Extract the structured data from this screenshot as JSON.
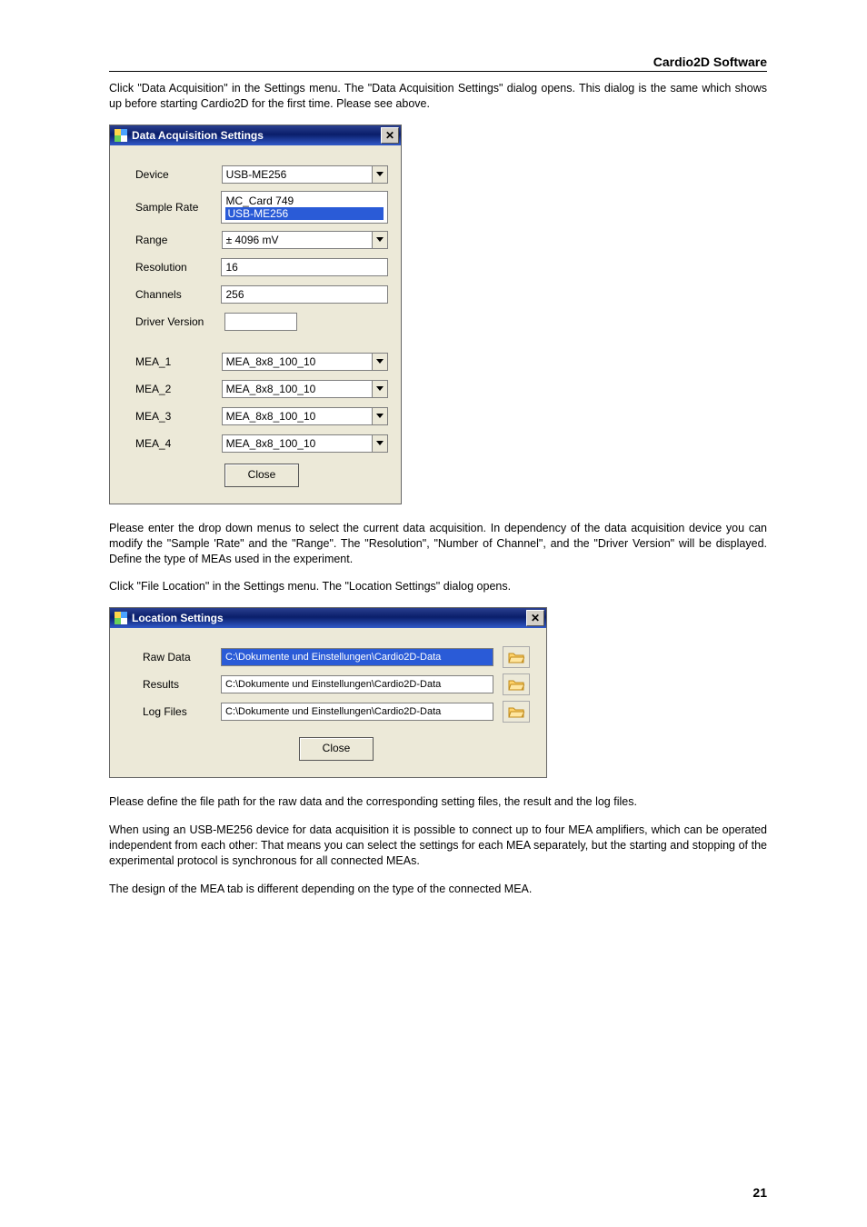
{
  "header": "Cardio2D Software",
  "para1": "Click \"Data Acquisition\" in the Settings menu. The \"Data Acquisition Settings\" dialog opens. This dialog is the same which shows up before starting Cardio2D for the first time. Please see above.",
  "dialog1": {
    "title": "Data Acquisition Settings",
    "labels": {
      "device": "Device",
      "sample_rate": "Sample Rate",
      "range": "Range",
      "resolution": "Resolution",
      "channels": "Channels",
      "driver_version": "Driver Version",
      "mea1": "MEA_1",
      "mea2": "MEA_2",
      "mea3": "MEA_3",
      "mea4": "MEA_4"
    },
    "values": {
      "device": "USB-ME256",
      "sample_rate_opt1": "MC_Card 749",
      "sample_rate_opt2": "USB-ME256",
      "range": "± 4096 mV",
      "resolution": "16",
      "channels": "256",
      "driver_version": "",
      "mea1": "MEA_8x8_100_10",
      "mea2": "MEA_8x8_100_10",
      "mea3": "MEA_8x8_100_10",
      "mea4": "MEA_8x8_100_10"
    },
    "close": "Close"
  },
  "para2": "Please enter the drop down menus to select the current data acquisition. In dependency of the data acquisition device you can modify the \"Sample 'Rate\" and the \"Range\". The \"Resolution\", \"Number of Channel\", and the \"Driver Version\" will be displayed. Define the type of MEAs used in the experiment.",
  "para3": "Click \"File Location\" in the Settings menu. The \"Location Settings\" dialog opens.",
  "dialog2": {
    "title": "Location Settings",
    "labels": {
      "raw": "Raw Data",
      "results": "Results",
      "logs": "Log Files"
    },
    "values": {
      "raw": "C:\\Dokumente und Einstellungen\\Cardio2D-Data",
      "results": "C:\\Dokumente und Einstellungen\\Cardio2D-Data",
      "logs": "C:\\Dokumente und Einstellungen\\Cardio2D-Data"
    },
    "close": "Close"
  },
  "para4": "Please define the file path for the raw data and the corresponding setting files, the result and the log files.",
  "para5": "When using an USB-ME256 device for data acquisition it is possible to connect up to four MEA amplifiers, which can be operated independent from each other: That means you can select the settings for each MEA separately, but the starting and stopping of the experimental protocol is synchronous for all connected MEAs.",
  "para6": "The design of the MEA tab is different depending on the type of the connected MEA.",
  "page_number": "21"
}
